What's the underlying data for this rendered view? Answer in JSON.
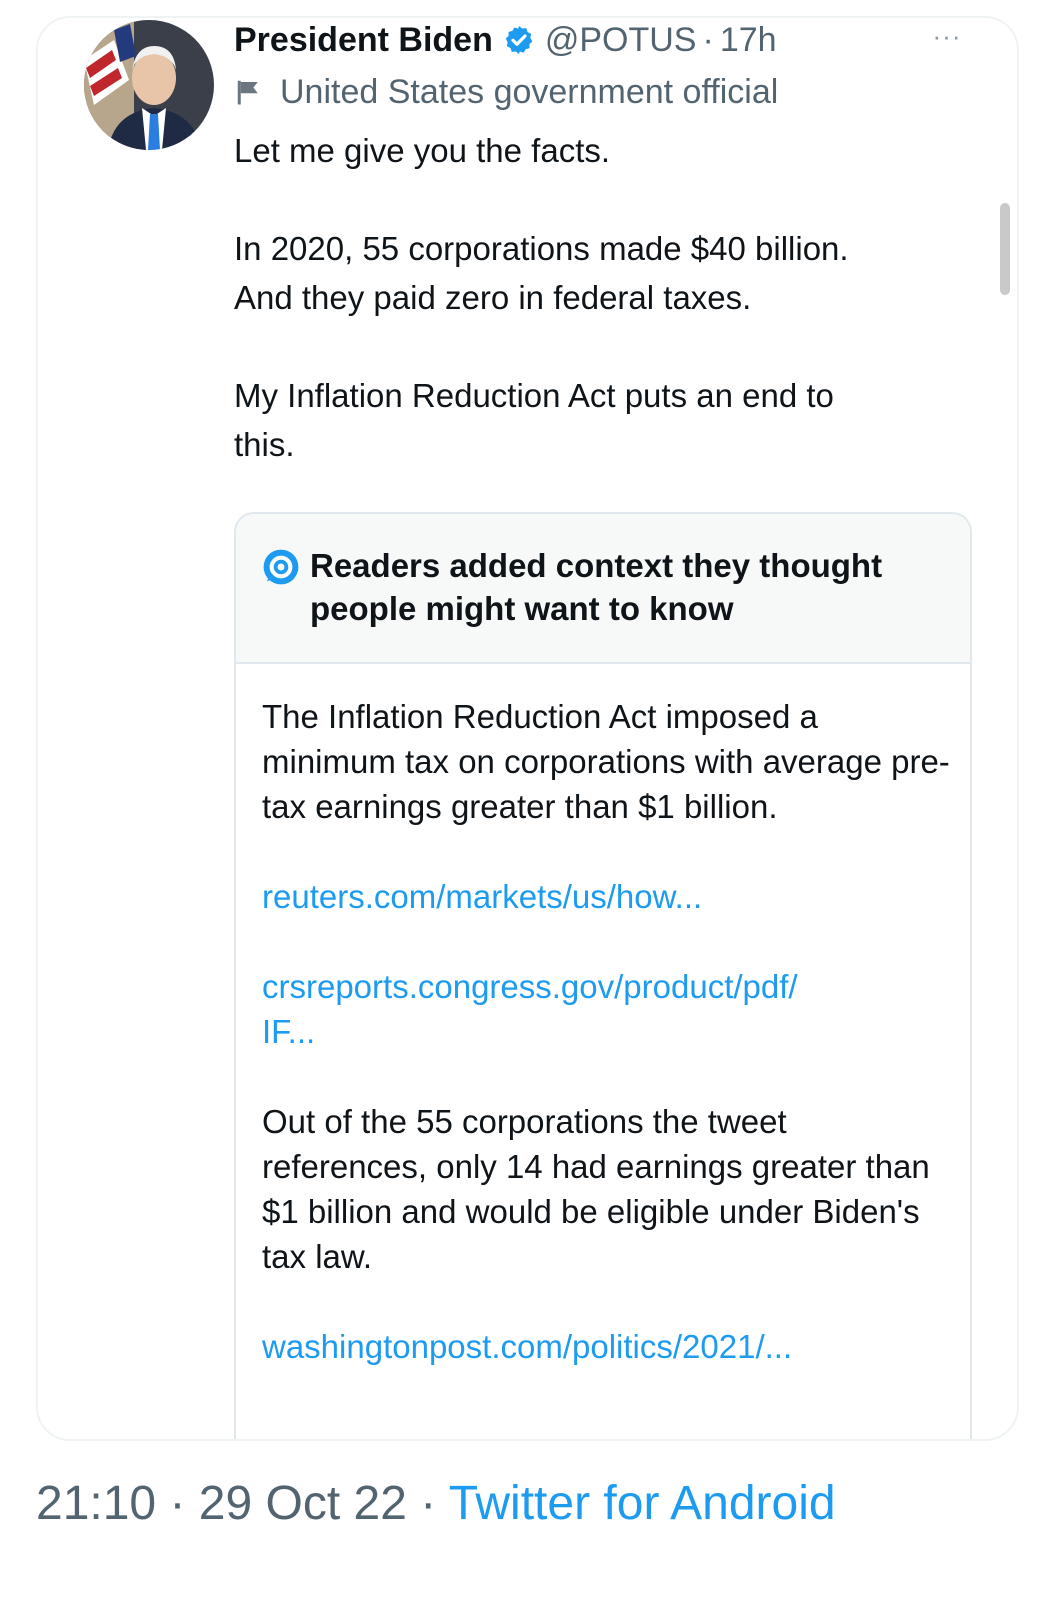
{
  "tweet": {
    "author_name": "President Biden",
    "handle": "@POTUS",
    "separator": "·",
    "time_ago": "17h",
    "more_label": "···",
    "account_label": "United States government official",
    "text": {
      "line_1": "Let me give you the facts.",
      "line_2a": "In 2020, 55 corporations made $40 billion.",
      "line_2b": "And they paid zero in federal taxes.",
      "line_3a": "My Inflation Reduction Act puts an end to",
      "line_3b": "this."
    }
  },
  "community_note": {
    "title": "Readers added context they thought people might want to know",
    "paragraph_1": "The Inflation Reduction Act imposed a minimum tax on corporations with average pre-tax earnings greater than $1 billion.",
    "link_1": "reuters.com/markets/us/how...",
    "link_2a": "crsreports.congress.gov/product/pdf/",
    "link_2b": "IF...",
    "paragraph_2": "Out of the 55 corporations the tweet references, only 14 had earnings greater than $1 billion and would be eligible under Biden's tax law.",
    "link_3": "washingtonpost.com/politics/2021/..."
  },
  "footer": {
    "time": "21:10",
    "date": "29 Oct 22",
    "separator": "·",
    "source": "Twitter for Android"
  },
  "icons": {
    "verified": "verified-badge-icon",
    "flag": "government-flag-icon",
    "note": "community-notes-icon",
    "more": "more-options-icon"
  },
  "colors": {
    "accent": "#1d9bf0",
    "muted": "#536471",
    "text": "#0f1419",
    "note_header_bg": "#f7f9f9"
  }
}
